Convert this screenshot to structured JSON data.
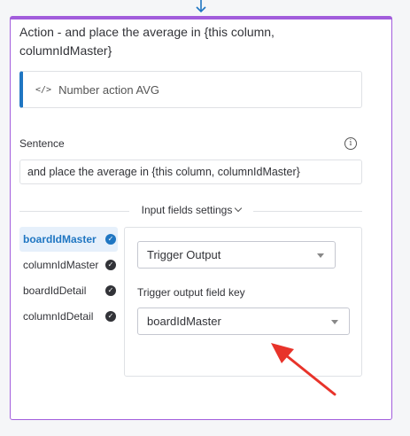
{
  "card": {
    "title": "Action - and place the average in {this column, columnIdMaster}",
    "action_label": "Number action AVG",
    "code_icon": "</>"
  },
  "sentence": {
    "label": "Sentence",
    "value": "and place the average in {this column, columnIdMaster}"
  },
  "input_fields": {
    "toggle_label": "Input fields settings",
    "items": [
      {
        "label": "boardIdMaster",
        "selected": true
      },
      {
        "label": "columnIdMaster"
      },
      {
        "label": "boardIdDetail"
      },
      {
        "label": "columnIdDetail"
      }
    ]
  },
  "settings": {
    "trigger_select_value": "Trigger Output",
    "field_key_label": "Trigger output field key",
    "field_key_value": "boardIdMaster"
  },
  "colors": {
    "accent_purple": "#a25ddc",
    "accent_blue": "#1f76c2",
    "annotation_red": "#e8332a"
  }
}
